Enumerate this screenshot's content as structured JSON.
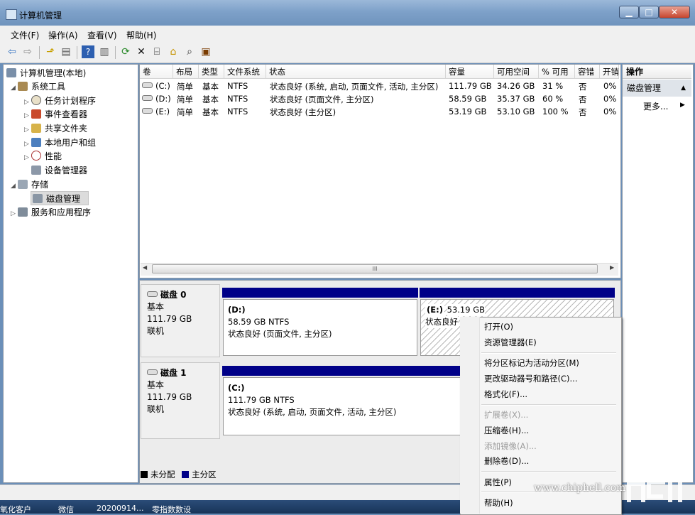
{
  "window": {
    "title": "计算机管理"
  },
  "menubar": {
    "items": [
      "文件(F)",
      "操作(A)",
      "查看(V)",
      "帮助(H)"
    ]
  },
  "toolbar": {
    "icons": [
      "back-icon",
      "forward-icon",
      "up-icon",
      "show-hide-tree-icon",
      "help-icon",
      "view-icon",
      "refresh-icon",
      "delete-icon",
      "properties-icon",
      "open-icon",
      "search-icon",
      "export-icon"
    ]
  },
  "tree": {
    "root": "计算机管理(本地)",
    "system_tools": "系统工具",
    "task_scheduler": "任务计划程序",
    "event_viewer": "事件查看器",
    "shared_folders": "共享文件夹",
    "local_users": "本地用户和组",
    "performance": "性能",
    "device_manager": "设备管理器",
    "storage": "存储",
    "disk_management": "磁盘管理",
    "services_apps": "服务和应用程序"
  },
  "volumes": {
    "headers": [
      "卷",
      "布局",
      "类型",
      "文件系统",
      "状态",
      "容量",
      "可用空间",
      "% 可用",
      "容错",
      "开销"
    ],
    "rows": [
      [
        "(C:)",
        "简单",
        "基本",
        "NTFS",
        "状态良好 (系统, 启动, 页面文件, 活动, 主分区)",
        "111.79 GB",
        "34.26 GB",
        "31 %",
        "否",
        "0%"
      ],
      [
        "(D:)",
        "简单",
        "基本",
        "NTFS",
        "状态良好 (页面文件, 主分区)",
        "58.59 GB",
        "35.37 GB",
        "60 %",
        "否",
        "0%"
      ],
      [
        "(E:)",
        "简单",
        "基本",
        "NTFS",
        "状态良好 (主分区)",
        "53.19 GB",
        "53.10 GB",
        "100 %",
        "否",
        "0%"
      ]
    ],
    "scroll_grip": "III"
  },
  "disks": [
    {
      "name": "磁盘 0",
      "type": "基本",
      "size": "111.79 GB",
      "status": "联机",
      "partitions": [
        {
          "letter": "(D:)",
          "info": "58.59 GB NTFS",
          "status": "状态良好 (页面文件, 主分区)"
        },
        {
          "letter": "(E:)",
          "info": "53.19 GB",
          "status": "状态良好"
        }
      ]
    },
    {
      "name": "磁盘 1",
      "type": "基本",
      "size": "111.79 GB",
      "status": "联机",
      "partitions": [
        {
          "letter": "(C:)",
          "info": "111.79 GB NTFS",
          "status": "状态良好 (系统, 启动, 页面文件, 活动, 主分区)"
        }
      ]
    }
  ],
  "legend": {
    "unallocated": "未分配",
    "primary": "主分区"
  },
  "actions": {
    "header": "操作",
    "section": "磁盘管理",
    "more": "更多..."
  },
  "context_menu": {
    "items": [
      {
        "label": "打开(O)",
        "enabled": true
      },
      {
        "label": "资源管理器(E)",
        "enabled": true
      },
      {
        "label": "将分区标记为活动分区(M)",
        "enabled": true
      },
      {
        "label": "更改驱动器号和路径(C)...",
        "enabled": true
      },
      {
        "label": "格式化(F)...",
        "enabled": true
      },
      {
        "label": "扩展卷(X)...",
        "enabled": false
      },
      {
        "label": "压缩卷(H)...",
        "enabled": true
      },
      {
        "label": "添加镜像(A)...",
        "enabled": false
      },
      {
        "label": "删除卷(D)...",
        "enabled": true
      },
      {
        "label": "属性(P)",
        "enabled": true
      },
      {
        "label": "帮助(H)",
        "enabled": true
      }
    ]
  },
  "taskbar": {
    "items": [
      "氧化客户",
      "微信",
      "20200914...",
      "零指数数设"
    ]
  },
  "watermark": {
    "url": "www.chiphell.com",
    "logo": "chip hell"
  },
  "colors": {
    "primary_partition": "#000088",
    "unallocated": "#000000",
    "title_bar": "#7ea1c9"
  }
}
